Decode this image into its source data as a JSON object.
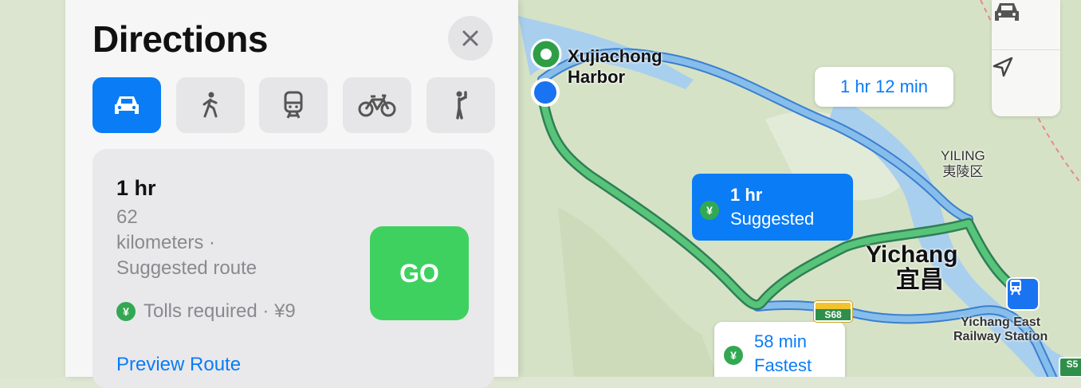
{
  "panel": {
    "title": "Directions",
    "modes": [
      {
        "icon": "car-icon",
        "active": true
      },
      {
        "icon": "walk-icon",
        "active": false
      },
      {
        "icon": "train-icon",
        "active": false
      },
      {
        "icon": "bike-icon",
        "active": false
      },
      {
        "icon": "rideshare-icon",
        "active": false
      }
    ],
    "route": {
      "time": "1 hr",
      "distance_line1": "62",
      "distance_line2": "kilometers ·",
      "type": "Suggested route",
      "tolls_badge": "¥",
      "tolls": "Tolls required · ¥9",
      "go_label": "GO",
      "preview_label": "Preview Route"
    }
  },
  "map": {
    "origin_label_line1": "Xujiachong",
    "origin_label_line2": "Harbor",
    "callout_alt_top": "1 hr 12 min",
    "callout_suggested_time": "1 hr",
    "callout_suggested_label": "Suggested",
    "callout_suggested_badge": "¥",
    "callout_fastest_time": "58 min",
    "callout_fastest_label": "Fastest",
    "callout_fastest_badge": "¥",
    "district_en": "YILING",
    "district_zh": "夷陵区",
    "city_en": "Yichang",
    "city_zh": "宜昌",
    "station_line1": "Yichang East",
    "station_line2": "Railway Station",
    "highway_shield": "S68",
    "highway_shield_right": "S5"
  },
  "colors": {
    "accent": "#0a7cf6",
    "go_green": "#3fd160",
    "route_green": "#58c47a",
    "route_blue": "#7fb8e8",
    "water": "#a9cfee"
  }
}
